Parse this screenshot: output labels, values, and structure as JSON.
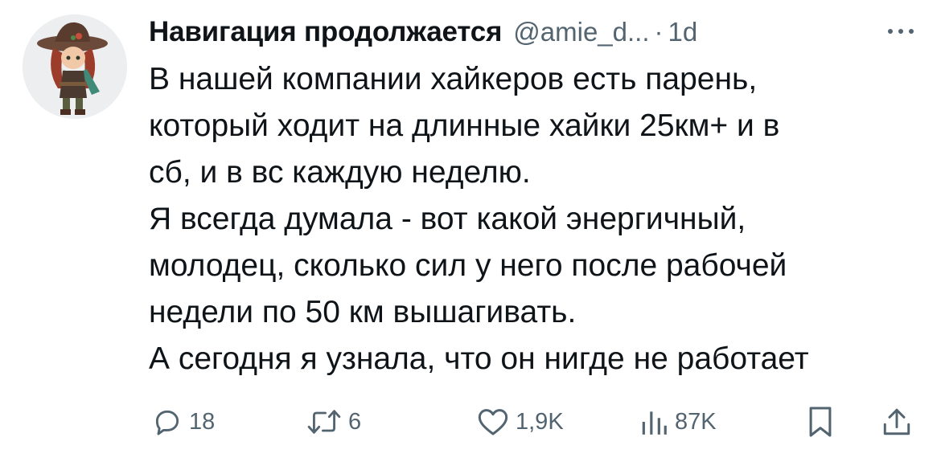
{
  "tweet": {
    "author": {
      "display_name": "Навигация продолжается",
      "handle": "@amie_d...",
      "separator": "·",
      "time": "1d"
    },
    "text_lines": [
      "В нашей компании хайкеров есть парень,",
      "который ходит на длинные хайки 25км+ и в",
      "сб, и в вс каждую неделю.",
      "Я всегда думала - вот какой энергичный,",
      "молодец, сколько сил у него после рабочей",
      "недели по 50 км вышагивать.",
      "А сегодня я узнала, что он нигде не работает"
    ],
    "actions": {
      "reply": {
        "icon": "reply-icon",
        "count": "18"
      },
      "retweet": {
        "icon": "retweet-icon",
        "count": "6"
      },
      "like": {
        "icon": "heart-icon",
        "count": "1,9K"
      },
      "views": {
        "icon": "views-icon",
        "count": "87K"
      },
      "bookmark": {
        "icon": "bookmark-icon"
      },
      "share": {
        "icon": "share-icon"
      }
    },
    "more_icon": "more-icon"
  },
  "colors": {
    "text": "#0f1419",
    "secondary": "#536471",
    "background": "#ffffff"
  }
}
